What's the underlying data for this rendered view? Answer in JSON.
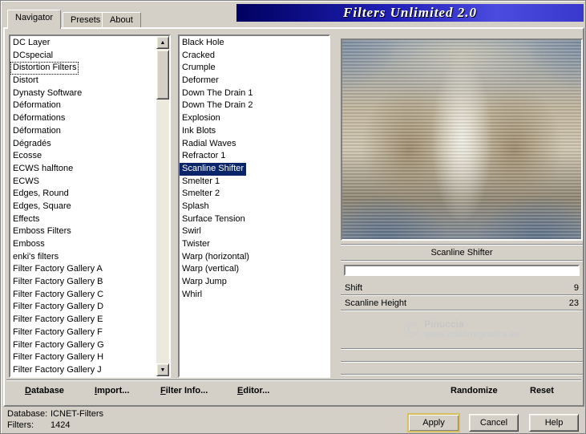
{
  "window": {
    "banner_title": "Filters Unlimited 2.0"
  },
  "tabs": [
    {
      "label": "Navigator"
    },
    {
      "label": "Presets"
    },
    {
      "label": "About"
    }
  ],
  "category_list": {
    "items": [
      "DC Layer",
      "DCspecial",
      "Distortion Filters",
      "Distort",
      "Dynasty Software",
      "Déformation",
      "Déformations",
      "Déformation",
      "Dégradés",
      "Ecosse",
      "ECWS halftone",
      "ECWS",
      "Edges, Round",
      "Edges, Square",
      "Effects",
      "Emboss Filters",
      "Emboss",
      "enki's filters",
      "Filter Factory Gallery A",
      "Filter Factory Gallery B",
      "Filter Factory Gallery C",
      "Filter Factory Gallery D",
      "Filter Factory Gallery E",
      "Filter Factory Gallery F",
      "Filter Factory Gallery G",
      "Filter Factory Gallery H",
      "Filter Factory Gallery J"
    ],
    "selected": "Distortion Filters"
  },
  "filter_list": {
    "items": [
      "Black Hole",
      "Cracked",
      "Crumple",
      "Deformer",
      "Down The Drain 1",
      "Down The Drain 2",
      "Explosion",
      "Ink Blots",
      "Radial Waves",
      "Refractor 1",
      "Scanline Shifter",
      "Smelter 1",
      "Smelter 2",
      "Splash",
      "Surface Tension",
      "Swirl",
      "Twister",
      "Warp (horizontal)",
      "Warp (vertical)",
      "Warp Jump",
      "Whirl"
    ],
    "selected": "Scanline Shifter"
  },
  "preview": {
    "filter_name": "Scanline Shifter",
    "params": [
      {
        "label": "Shift",
        "value": "9"
      },
      {
        "label": "Scanline Height",
        "value": "23"
      }
    ],
    "watermark": {
      "symbol": "©",
      "line1": "Pinuccia",
      "line2": "www.maldiregrafica.eu"
    }
  },
  "toolbar": {
    "buttons": [
      {
        "label": "Database"
      },
      {
        "label": "Import..."
      },
      {
        "label": "Filter Info..."
      },
      {
        "label": "Editor..."
      },
      {
        "label": "Randomize"
      },
      {
        "label": "Reset"
      }
    ]
  },
  "status": {
    "database_label": "Database:",
    "database_value": "ICNET-Filters",
    "filters_label": "Filters:",
    "filters_value": "1424"
  },
  "actions": {
    "apply": "Apply",
    "cancel": "Cancel",
    "help": "Help"
  },
  "icons": {
    "scroll_up": "▲",
    "scroll_down": "▼"
  },
  "colors": {
    "selection": "#0a246a",
    "banner_dark": "#000060",
    "banner_light": "#4b4be0",
    "chrome": "#d4d0c8"
  }
}
